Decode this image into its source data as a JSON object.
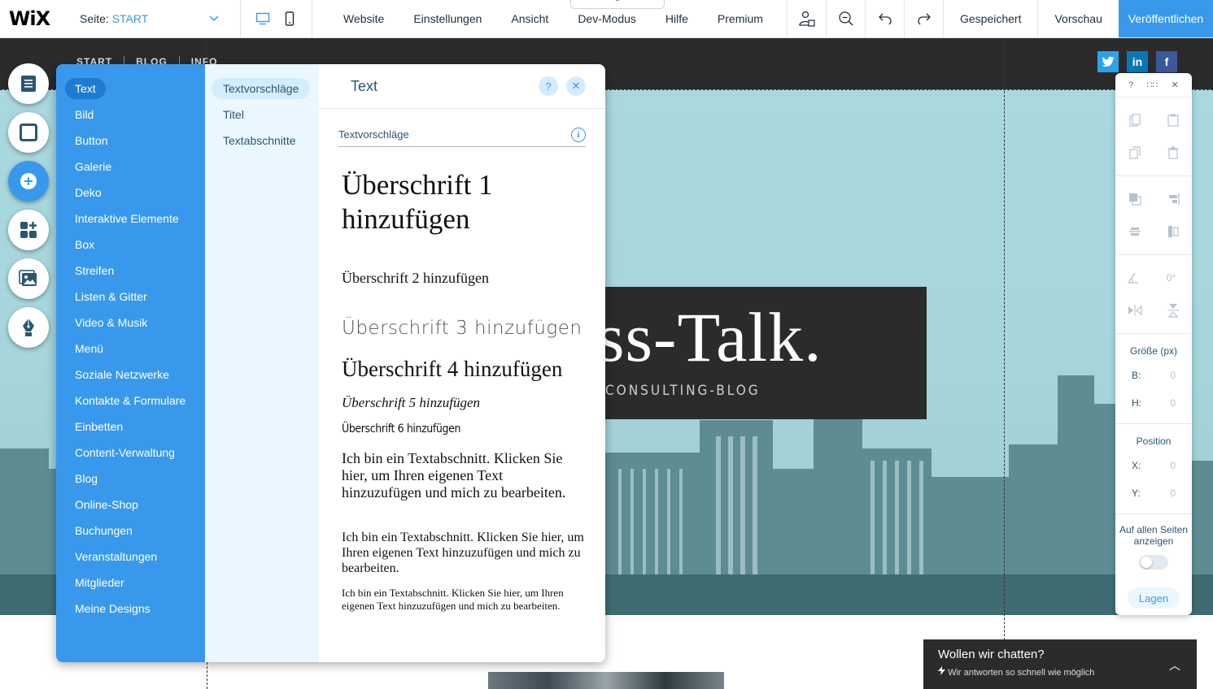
{
  "topbar": {
    "logo": "WiX",
    "page_label": "Seite:",
    "page_name": "START",
    "menu": [
      "Website",
      "Einstellungen",
      "Ansicht",
      "Dev-Modus",
      "Hilfe",
      "Premium"
    ],
    "dev_tab_glyph": "⌃",
    "saved_label": "Gespeichert",
    "preview_label": "Vorschau",
    "publish_label": "Veröffentlichen",
    "accent_color": "#3899ec"
  },
  "site": {
    "nav": [
      "START",
      "BLOG",
      "INFO"
    ],
    "social": [
      "t",
      "in",
      "f"
    ],
    "title_partial": "ss-Talk.",
    "subtitle_partial": "CONSULTING-BLOG",
    "chat_title": "Wollen wir chatten?",
    "chat_sub": "Wir antworten so schnell wie möglich",
    "chat_chevron": "︿"
  },
  "add_panel": {
    "categories": [
      "Text",
      "Bild",
      "Button",
      "Galerie",
      "Deko",
      "Interaktive Elemente",
      "Box",
      "Streifen",
      "Listen & Gitter",
      "Video & Musik",
      "Menü",
      "Soziale Netzwerke",
      "Kontakte & Formulare",
      "Einbetten",
      "Content-Verwaltung",
      "Blog",
      "Online-Shop",
      "Buchungen",
      "Veranstaltungen",
      "Mitglieder",
      "Meine Designs"
    ],
    "subcategories": [
      "Textvorschläge",
      "Titel",
      "Textabschnitte"
    ],
    "title": "Text",
    "help": "?",
    "close": "✕",
    "section_title": "Textvorschläge",
    "info": "i",
    "presets": {
      "h1": "Überschrift 1 hinzufügen",
      "h2": "Überschrift 2 hinzufügen",
      "h3": "Überschrift 3 hinzufügen",
      "h4": "Überschrift 4 hinzufügen",
      "h5": "Überschrift 5 hinzufügen",
      "h6": "Überschrift 6 hinzufügen",
      "p1": "Ich bin ein Textabschnitt. Klicken Sie hier, um Ihren eigenen Text hinzuzufügen und mich zu bearbeiten.",
      "p2": "Ich bin ein Textabschnitt. Klicken Sie hier, um Ihren eigenen Text hinzuzufügen und mich zu bearbeiten.",
      "p3": "Ich bin ein Textabschnitt. Klicken Sie hier, um Ihren eigenen Text hinzuzufügen und mich zu bearbeiten."
    }
  },
  "inspector": {
    "help": "?",
    "drag": "∷∷",
    "close": "✕",
    "rotation": "0°",
    "size_label": "Größe (px)",
    "width_key": "B:",
    "width_val": "0",
    "height_key": "H:",
    "height_val": "0",
    "position_label": "Position",
    "x_key": "X:",
    "x_val": "0",
    "y_key": "Y:",
    "y_val": "0",
    "show_all_pages": "Auf allen Seiten anzeigen",
    "layers": "Lagen"
  }
}
